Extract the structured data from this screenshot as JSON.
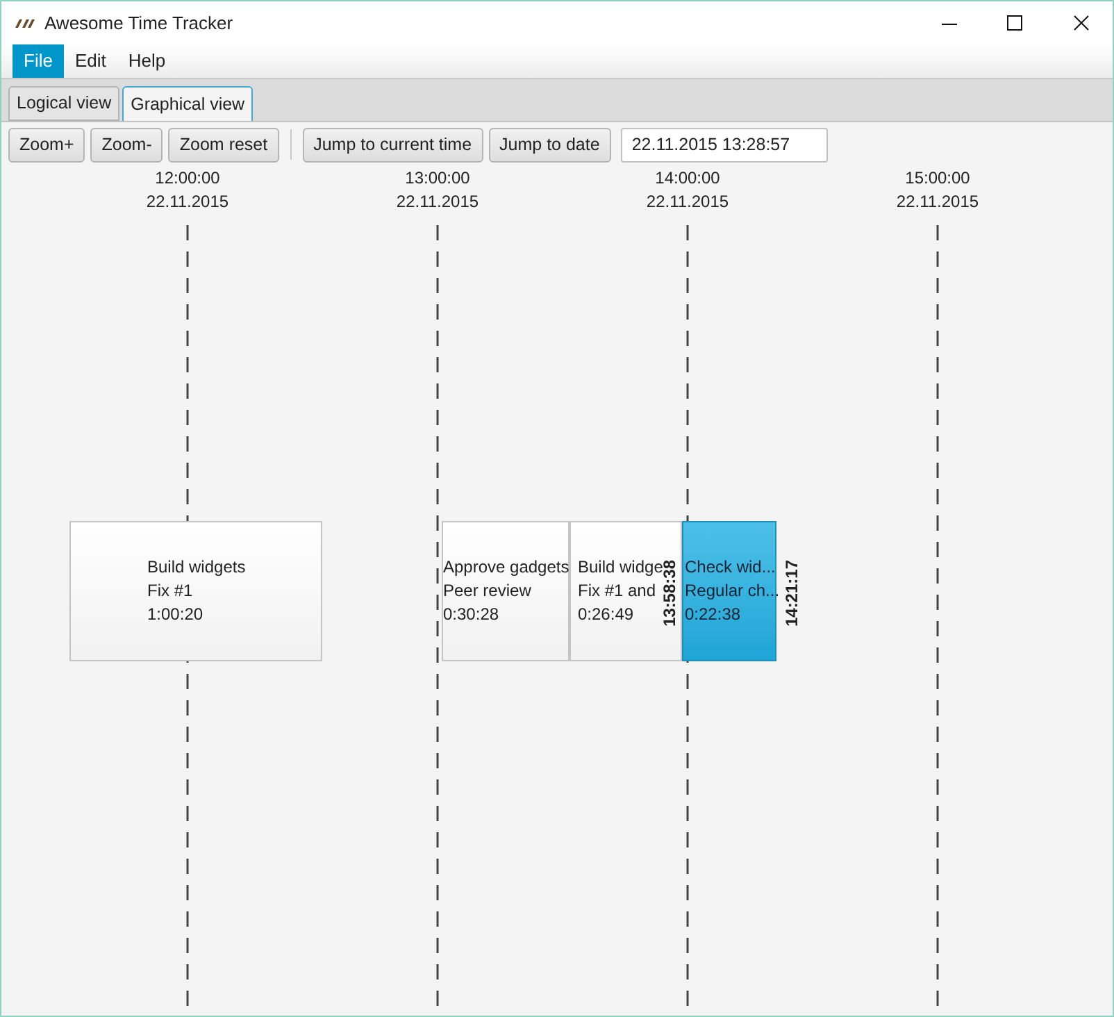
{
  "window": {
    "title": "Awesome Time Tracker"
  },
  "menu": [
    {
      "label": "File",
      "selected": true
    },
    {
      "label": "Edit",
      "selected": false
    },
    {
      "label": "Help",
      "selected": false
    }
  ],
  "tabs": [
    {
      "label": "Logical view",
      "selected": false
    },
    {
      "label": "Graphical view",
      "selected": true
    }
  ],
  "toolbar": {
    "buttons": [
      [
        "Zoom+",
        "Zoom-",
        "Zoom reset"
      ],
      [
        "Jump to current time",
        "Jump to date"
      ]
    ],
    "date_field": {
      "value": "22.11.2015 13:28:57"
    }
  },
  "timeline": {
    "ticks": [
      {
        "time": "12:00:00",
        "date": "22.11.2015"
      },
      {
        "time": "13:00:00",
        "date": "22.11.2015"
      },
      {
        "time": "14:00:00",
        "date": "22.11.2015"
      },
      {
        "time": "15:00:00",
        "date": "22.11.2015"
      }
    ],
    "entries": [
      {
        "lines": [
          "Build widgets",
          "Fix #1",
          "1:00:20"
        ],
        "selected": false
      },
      {
        "lines": [
          "Approve gadgets",
          "Peer review",
          "0:30:28"
        ],
        "selected": false
      },
      {
        "lines": [
          "Build widge",
          "Fix #1 and",
          "0:26:49"
        ],
        "selected": false
      },
      {
        "lines": [
          "Check wid...",
          "Regular ch...",
          "0:22:38"
        ],
        "selected": true
      }
    ],
    "time_markers": [
      "13:58:38",
      "14:21:17"
    ]
  }
}
